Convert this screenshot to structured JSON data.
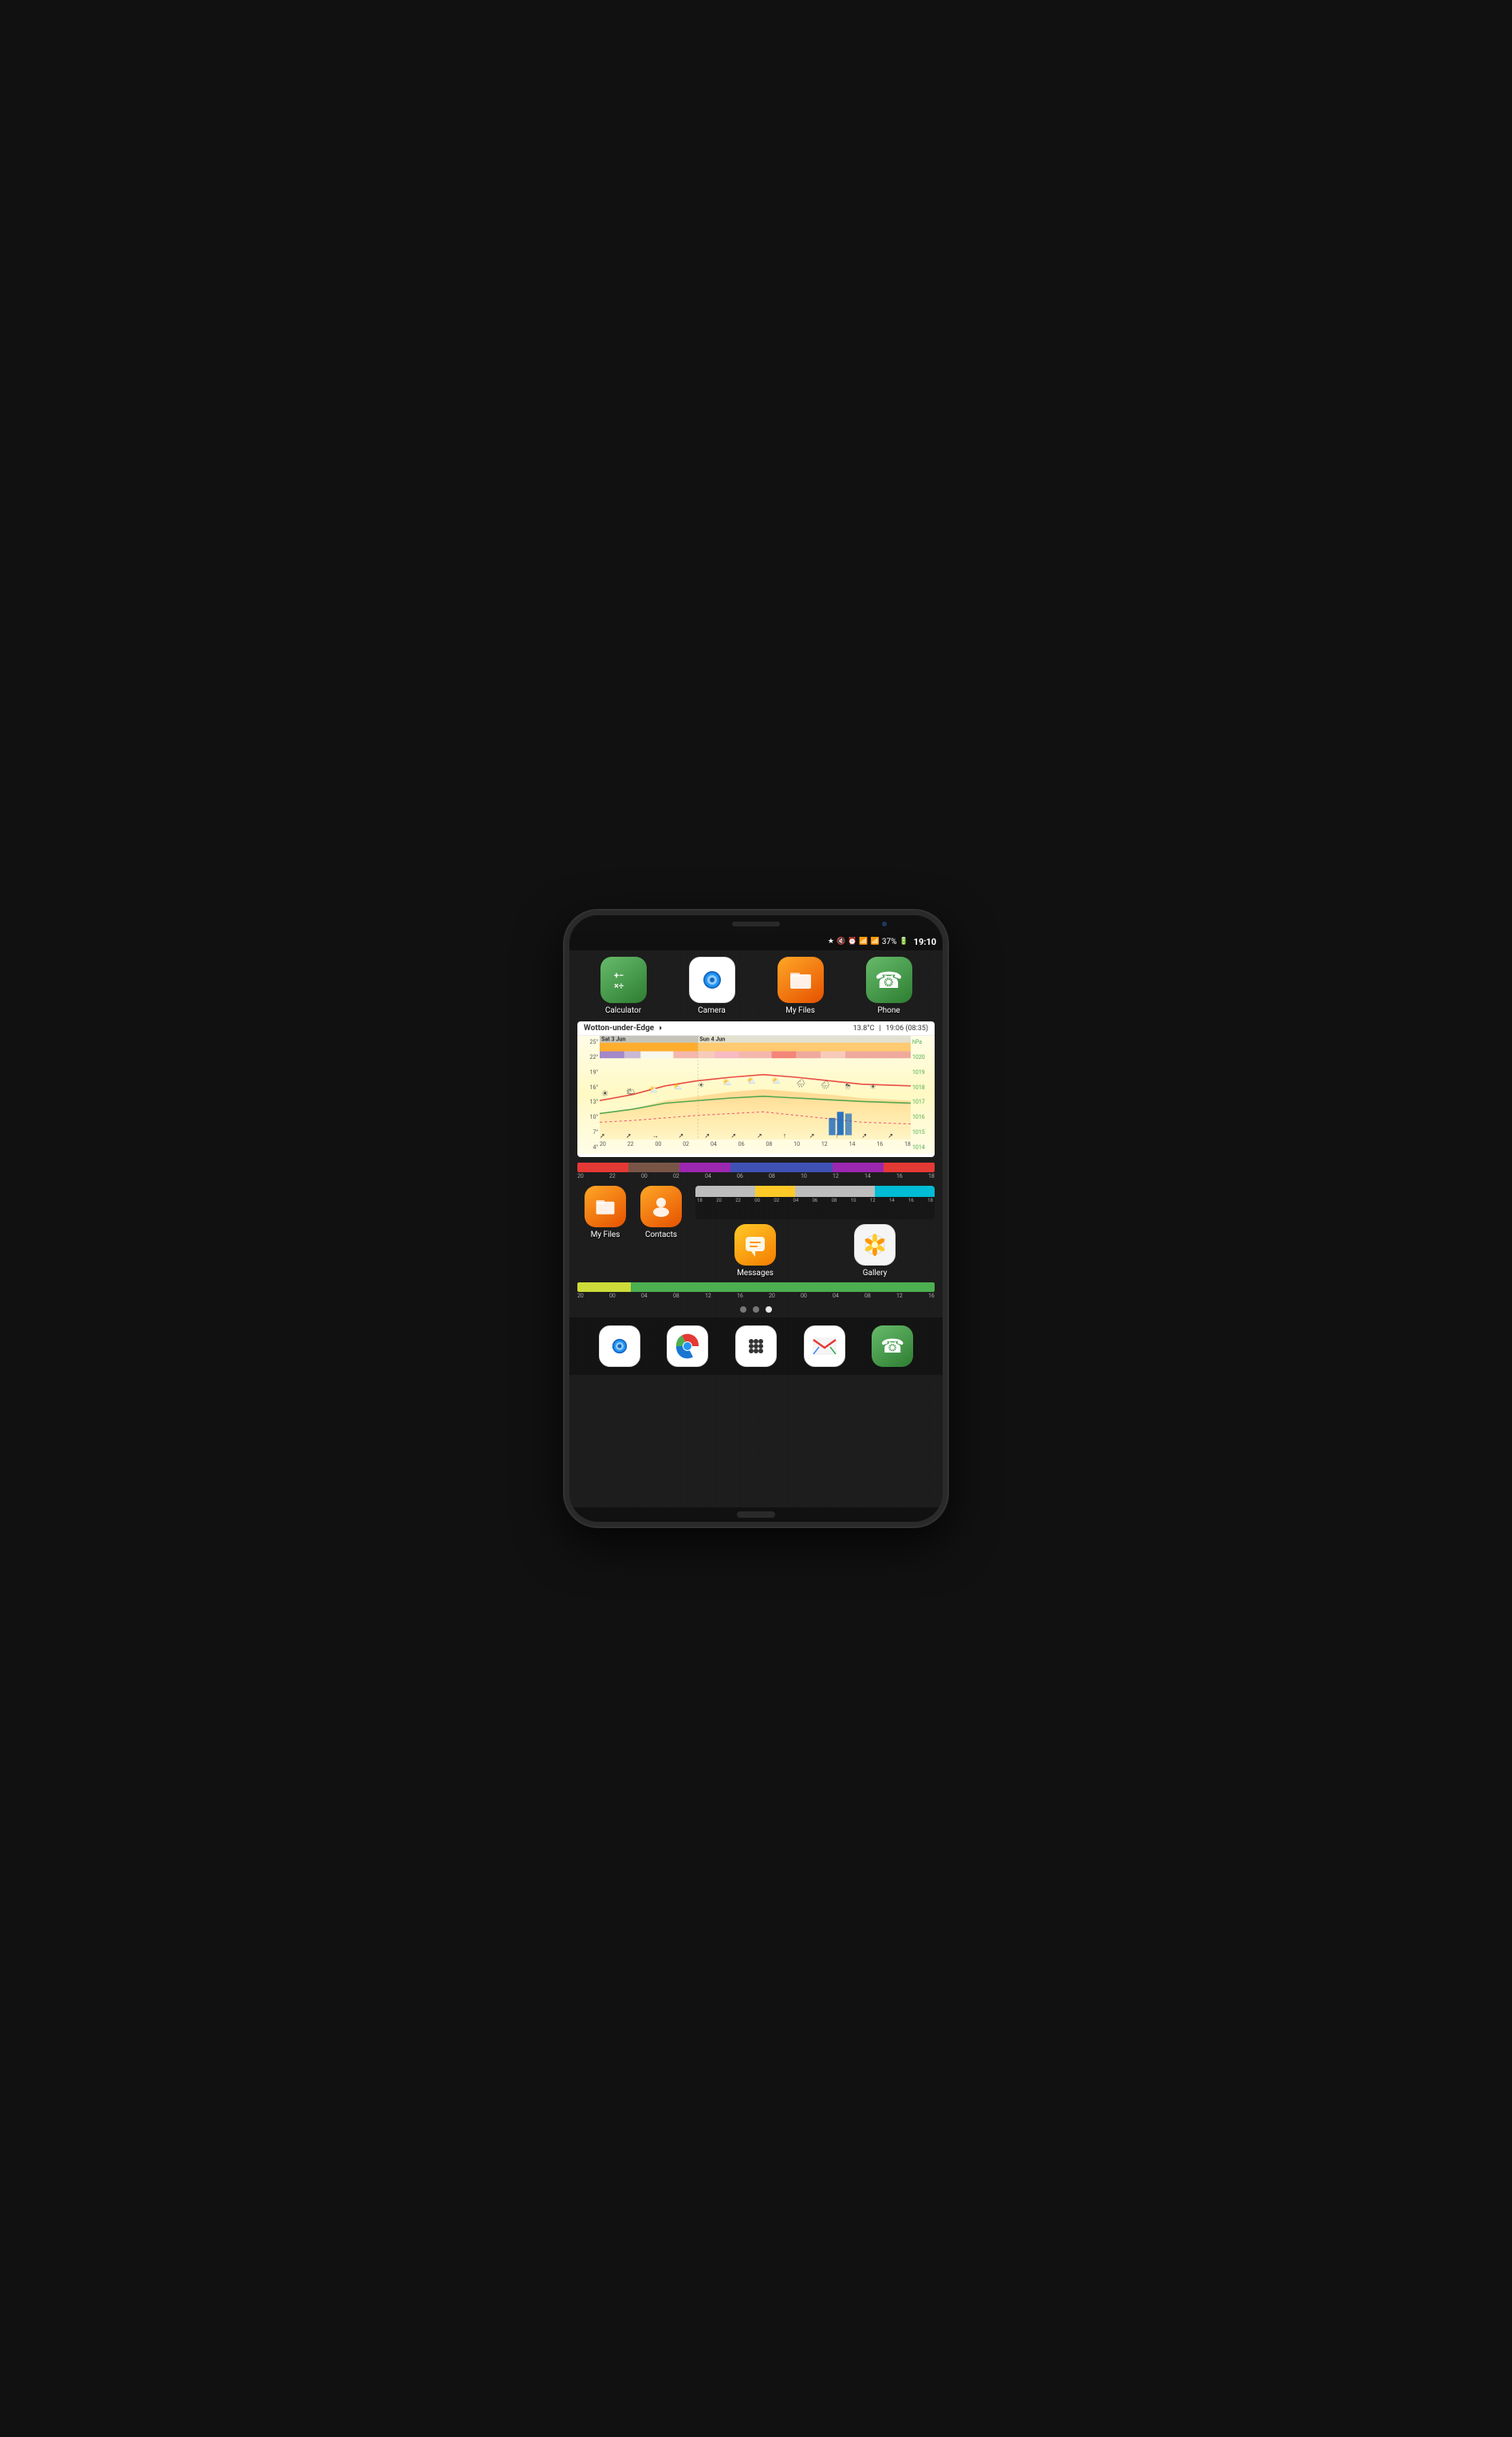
{
  "status_bar": {
    "time": "19:10",
    "battery_pct": "37%",
    "icons": [
      "bluetooth",
      "mute",
      "alarm",
      "wifi",
      "signal"
    ]
  },
  "top_apps": [
    {
      "id": "calculator",
      "label": "Calculator",
      "icon": "calc"
    },
    {
      "id": "camera",
      "label": "Camera",
      "icon": "camera"
    },
    {
      "id": "myfiles",
      "label": "My Files",
      "icon": "files"
    },
    {
      "id": "phone",
      "label": "Phone",
      "icon": "phone"
    }
  ],
  "weather_widget": {
    "location": "Wotton-under-Edge",
    "temp": "13.8°C",
    "time_info": "19:06 (08:35)",
    "date_sat": "Sat 3 Jun",
    "date_sun": "Sun 4 Jun",
    "temp_labels": [
      "25°",
      "22°",
      "19°",
      "16°",
      "13°",
      "10°",
      "7°",
      "4°"
    ],
    "pressure_labels": [
      "hPa",
      "1020",
      "1019",
      "1018",
      "1017",
      "1016",
      "1015",
      "1014"
    ],
    "time_labels": [
      "20",
      "22",
      "00",
      "02",
      "04",
      "06",
      "08",
      "10",
      "12",
      "14",
      "16",
      "18"
    ]
  },
  "color_bars": {
    "bar1_segments": [
      {
        "color": "#e53935",
        "flex": 1
      },
      {
        "color": "#795548",
        "flex": 1
      },
      {
        "color": "#9c27b0",
        "flex": 1
      },
      {
        "color": "#3f51b5",
        "flex": 2
      },
      {
        "color": "#9c27b0",
        "flex": 1
      },
      {
        "color": "#e53935",
        "flex": 1
      }
    ],
    "bar1_labels": [
      "20",
      "22",
      "00",
      "02",
      "04",
      "06",
      "08",
      "10",
      "12",
      "14",
      "16",
      "18"
    ],
    "bar2_segments": [
      {
        "color": "#bdbdbd",
        "flex": 3
      },
      {
        "color": "#ffca28",
        "flex": 2
      },
      {
        "color": "#bdbdbd",
        "flex": 4
      },
      {
        "color": "#00bcd4",
        "flex": 3
      }
    ],
    "bar2_labels": [
      "18",
      "20",
      "22",
      "00",
      "02",
      "04",
      "06",
      "08",
      "10",
      "12",
      "14",
      "16",
      "18"
    ],
    "progress_bar": {
      "yellow_pct": 15,
      "green_pct": 85
    },
    "progress_labels": [
      "20",
      "00",
      "04",
      "08",
      "12",
      "16",
      "20",
      "00",
      "04",
      "08",
      "12",
      "16"
    ]
  },
  "middle_apps": [
    {
      "id": "myfiles2",
      "label": "My Files",
      "icon": "files"
    },
    {
      "id": "contacts",
      "label": "Contacts",
      "icon": "contacts"
    }
  ],
  "right_apps": [
    {
      "id": "messages",
      "label": "Messages",
      "icon": "messages"
    },
    {
      "id": "gallery",
      "label": "Gallery",
      "icon": "gallery"
    }
  ],
  "dots": [
    {
      "active": false
    },
    {
      "active": false
    },
    {
      "active": true
    }
  ],
  "dock": [
    {
      "id": "camera2",
      "icon": "camera"
    },
    {
      "id": "chrome",
      "icon": "chrome"
    },
    {
      "id": "apps",
      "icon": "apps"
    },
    {
      "id": "gmail",
      "icon": "gmail"
    },
    {
      "id": "phone2",
      "icon": "phone"
    }
  ]
}
